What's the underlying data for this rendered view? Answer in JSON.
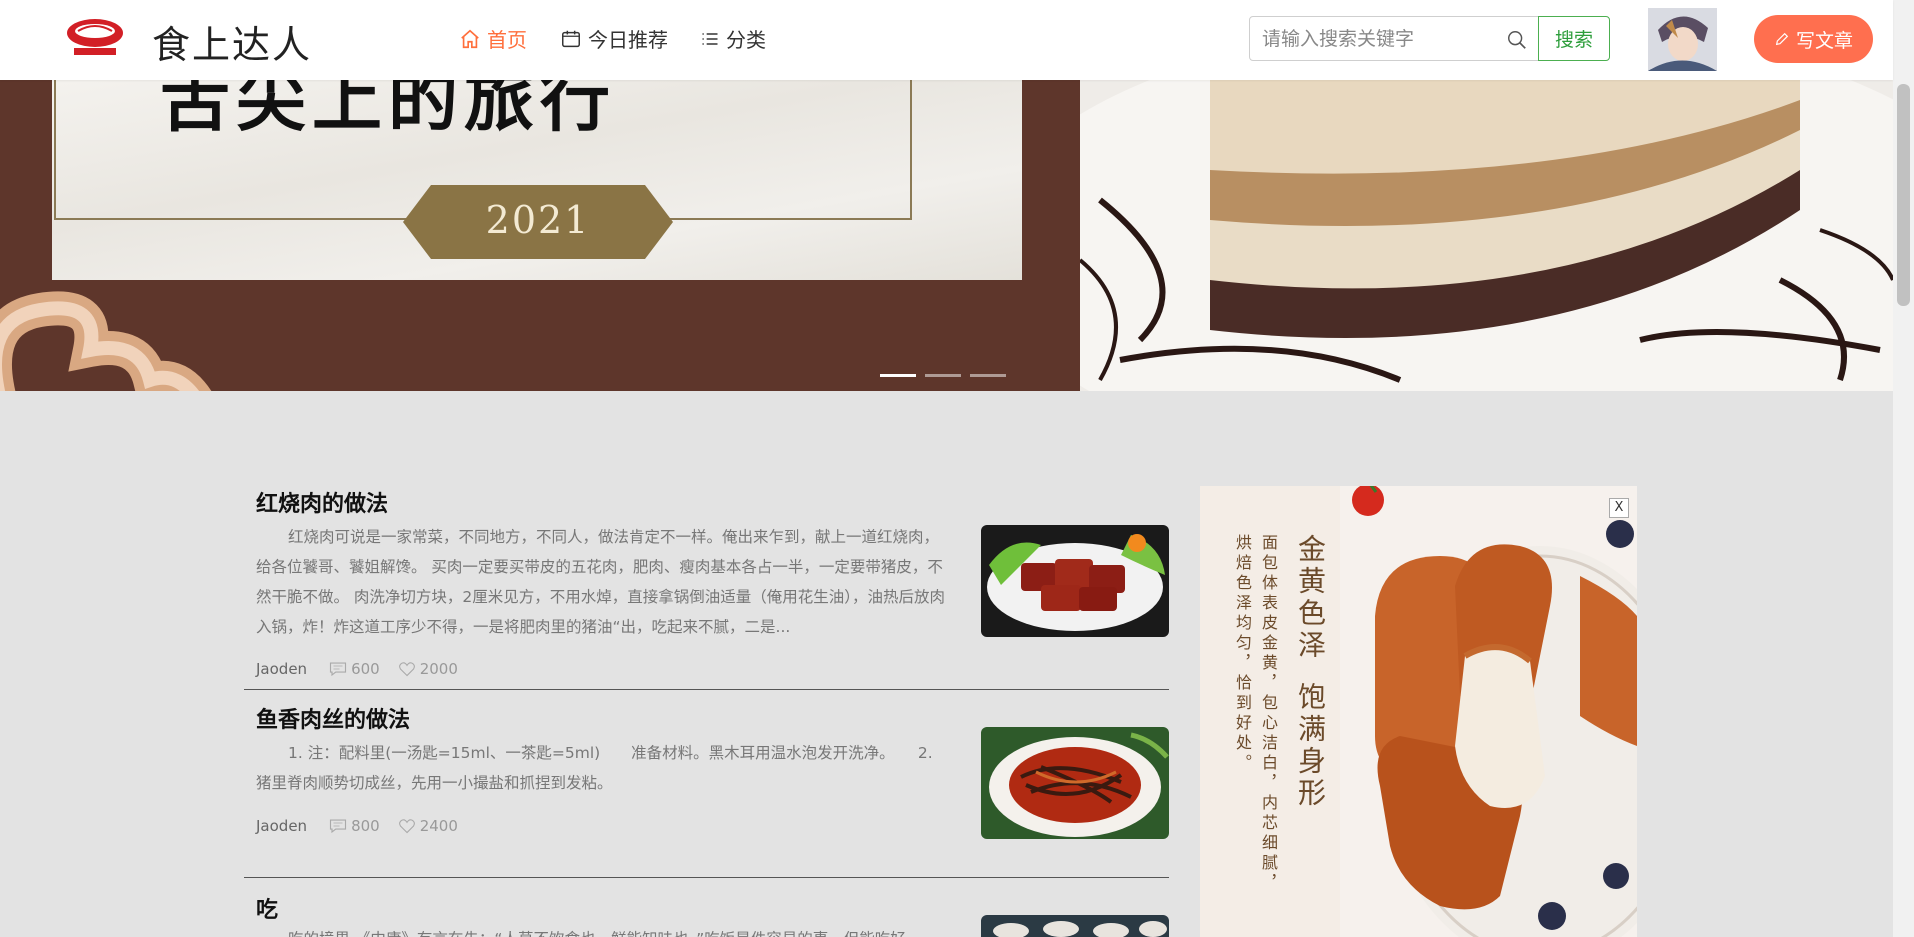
{
  "header": {
    "site_name": "食上达人",
    "nav": [
      {
        "label": "首页",
        "icon": "home-icon",
        "active": true
      },
      {
        "label": "今日推荐",
        "icon": "calendar-sale-icon",
        "active": false
      },
      {
        "label": "分类",
        "icon": "list-icon",
        "active": false
      }
    ],
    "search": {
      "placeholder": "请输入搜索关键字",
      "value": "",
      "button_label": "搜索"
    },
    "write_label": "写文章"
  },
  "banner": {
    "left_slide_title": "舌尖上的旅行",
    "left_slide_year": "2021",
    "slides_count": 3,
    "active_slide": 0
  },
  "articles": [
    {
      "title": "红烧肉的做法",
      "summary": "红烧肉可说是一家常菜，不同地方，不同人，做法肯定不一样。俺出来乍到，献上一道红烧肉，给各位饕哥、饕姐解馋。 买肉一定要买带皮的五花肉，肥肉、瘦肉基本各占一半，一定要带猪皮，不然干脆不做。 肉洗净切方块，2厘米见方，不用水焯，直接拿锅倒油适量（俺用花生油），油热后放肉入锅，炸！炸这道工序少不得，一是将肥肉里的猪油“出，吃起来不腻，二是...",
      "author": "Jaoden",
      "comments": "600",
      "likes": "2000"
    },
    {
      "title": "鱼香肉丝的做法",
      "summary": "1. 注：配料里(一汤匙=15ml、一茶匙=5ml)　　准备材料。黑木耳用温水泡发开洗净。　　2. 猪里脊肉顺势切成丝，先用一小撮盐和抓捏到发粘。",
      "author": "Jaoden",
      "comments": "800",
      "likes": "2400"
    },
    {
      "title": "吃",
      "summary": "吃的境界 《中庸》有言在先：“人莫不饮食也，鲜能知味也。”吃饭是件容易的事，但能吃好"
    }
  ],
  "ad": {
    "close_label": "X",
    "headline_1": "金黄色泽",
    "headline_2": "饱满身形",
    "body_1": "面包体表皮金黄，包心洁白，内芯细腻，",
    "body_2": "烘焙色泽均匀，恰到好处。"
  },
  "colors": {
    "accent": "#ff6f3c",
    "write_button": "#ff6f4f",
    "search_button": "#2e9e3c"
  }
}
